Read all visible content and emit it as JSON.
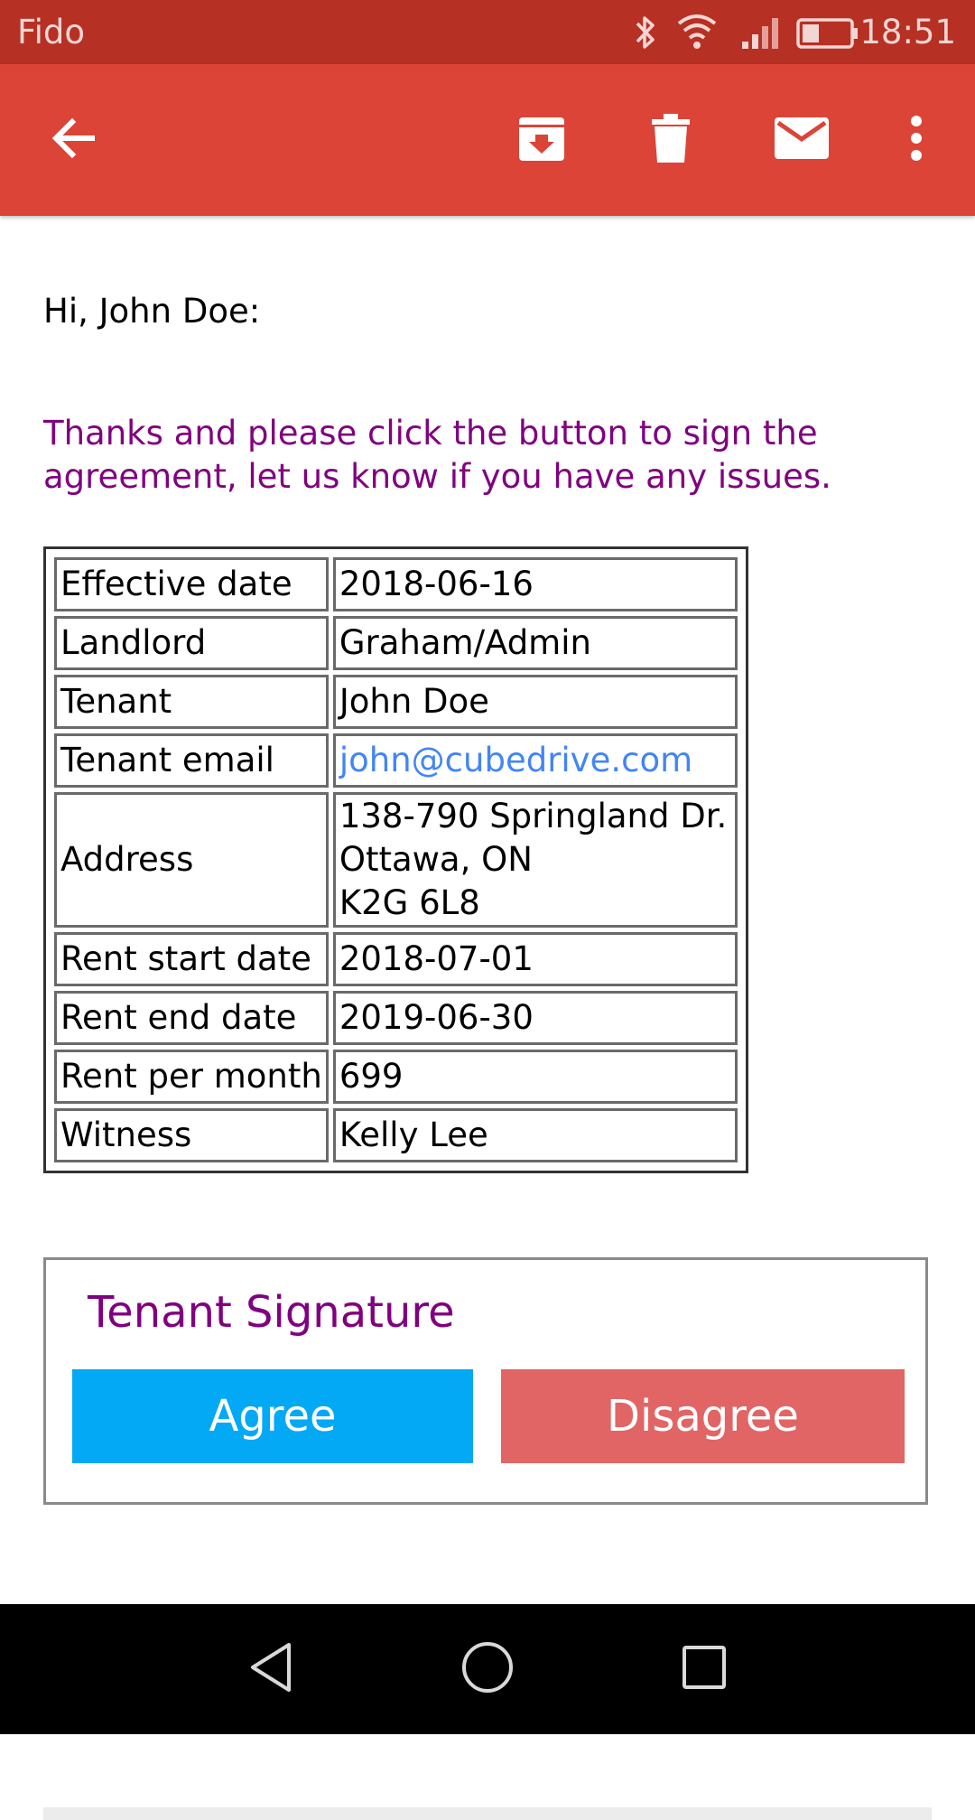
{
  "status_bar": {
    "carrier": "Fido",
    "time": "18:51",
    "icons": [
      "bluetooth-icon",
      "wifi-icon",
      "signal-icon",
      "battery-icon"
    ]
  },
  "toolbar": {
    "icons": [
      "back-arrow-icon",
      "archive-icon",
      "delete-icon",
      "mail-icon",
      "more-options-icon"
    ],
    "color": "#db4437"
  },
  "email": {
    "greeting": "Hi, John Doe:",
    "message_lines": [
      "Thanks and please click the button to sign the",
      "agreement, let us know if you have any issues."
    ],
    "details": [
      {
        "label": "Effective date",
        "value": "2018-06-16"
      },
      {
        "label": "Landlord",
        "value": "Graham/Admin"
      },
      {
        "label": "Tenant",
        "value": "John Doe"
      },
      {
        "label": "Tenant email",
        "value": "john@cubedrive.com"
      },
      {
        "label": "Address",
        "value_lines": [
          "138-790 Springland Dr.",
          "Ottawa, ON",
          "K2G 6L8"
        ]
      },
      {
        "label": "Rent start date",
        "value": "2018-07-01"
      },
      {
        "label": "Rent end date",
        "value": "2019-06-30"
      },
      {
        "label": "Rent per month",
        "value": "699"
      },
      {
        "label": "Witness",
        "value": "Kelly Lee"
      }
    ],
    "signature": {
      "title": "Tenant Signature",
      "agree_label": "Agree",
      "disagree_label": "Disagree",
      "agree_color": "#03a9f4",
      "disagree_color": "#e26565"
    }
  },
  "nav_bar": {
    "icons": [
      "back-triangle-icon",
      "home-circle-icon",
      "recents-square-icon"
    ]
  }
}
